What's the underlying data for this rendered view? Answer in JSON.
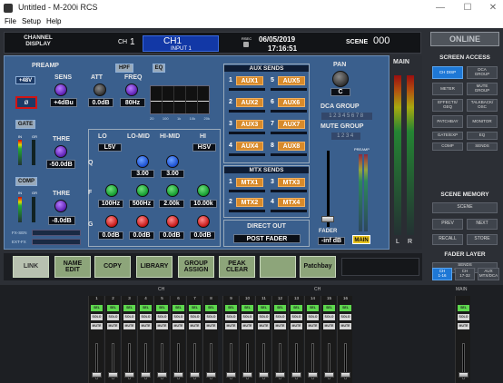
{
  "window": {
    "title": "Untitled - M-200i RCS",
    "minimize": "—",
    "maximize": "☐",
    "close": "✕"
  },
  "menu": [
    "File",
    "Setup",
    "Help"
  ],
  "header": {
    "channel_display": "CHANNEL\nDISPLAY",
    "ch_label": "CH",
    "ch_num": "1",
    "ch_name": "CH1",
    "input": "INPUT 1",
    "rs_label": "RSEC",
    "date": "06/05/2019",
    "time": "17:16:51",
    "scene_label": "SCENE",
    "scene_num": "000",
    "online": "ONLINE"
  },
  "preamp": {
    "title": "PREAMP",
    "phantom": "+48V",
    "sens_label": "SENS",
    "sens_value": "+4dBu",
    "phase": "ø",
    "att_label": "ATT",
    "att_value": "0.0dB",
    "hpf": "HPF",
    "eq": "EQ",
    "freq_label": "FREQ",
    "freq_value": "80Hz"
  },
  "graph": {
    "ticks": [
      "20",
      "100",
      "1k",
      "10k",
      "20k"
    ]
  },
  "gate": {
    "title": "GATE",
    "in": "IN",
    "gr": "GR",
    "thre": "THRE",
    "value": "-50.0dB"
  },
  "comp": {
    "title": "COMP",
    "in": "IN",
    "gr": "GR",
    "thre": "THRE",
    "value": "-8.0dB"
  },
  "fx": [
    "FX-SEN",
    "EXT-FX"
  ],
  "eq_bands": {
    "headers": [
      "LO",
      "LO-MID",
      "HI-MID",
      "HI"
    ],
    "types": [
      "L5V",
      "",
      "",
      "HSV"
    ],
    "q_label": "Q",
    "f_label": "F",
    "g_label": "G",
    "q": [
      "",
      "3.00",
      "3.00",
      ""
    ],
    "f": [
      "100Hz",
      "500Hz",
      "2.00k",
      "10.00k"
    ],
    "g": [
      "0.0dB",
      "0.0dB",
      "0.0dB",
      "0.0dB"
    ]
  },
  "aux_sends": {
    "title": "AUX SENDS",
    "items": [
      {
        "n": "1",
        "name": "AUX1"
      },
      {
        "n": "5",
        "name": "AUX5"
      },
      {
        "n": "2",
        "name": "AUX2"
      },
      {
        "n": "6",
        "name": "AUX6"
      },
      {
        "n": "3",
        "name": "AUX3"
      },
      {
        "n": "7",
        "name": "AUX7"
      },
      {
        "n": "4",
        "name": "AUX4"
      },
      {
        "n": "8",
        "name": "AUX8"
      }
    ]
  },
  "mtx_sends": {
    "title": "MTX SENDS",
    "items": [
      {
        "n": "1",
        "name": "MTX1"
      },
      {
        "n": "3",
        "name": "MTX3"
      },
      {
        "n": "2",
        "name": "MTX2"
      },
      {
        "n": "4",
        "name": "MTX4"
      }
    ]
  },
  "direct_out": {
    "title": "DIRECT OUT",
    "value": "POST FADER"
  },
  "pan": {
    "title": "PAN",
    "value": "C"
  },
  "dca": {
    "title": "DCA GROUP",
    "digits": "12345678"
  },
  "mute_group": {
    "title": "MUTE GROUP",
    "digits": "1234"
  },
  "fader": {
    "title": "FADER",
    "value": "-inf dB",
    "preamp": "PREAMP",
    "main": "MAIN"
  },
  "main_meter": {
    "title": "MAIN",
    "l": "L",
    "r": "R"
  },
  "functions": [
    "LINK",
    "NAME\nEDIT",
    "COPY",
    "LIBRARY",
    "GROUP\nASSIGN",
    "PEAK\nCLEAR",
    "",
    "Patchbay"
  ],
  "screen_access": {
    "title": "SCREEN ACCESS",
    "buttons": [
      "CH DISP",
      "DCA\nGROUP",
      "METER",
      "MUTE\nGROUP",
      "EFFECTS/\nGEQ",
      "TALKBACK/\nOSC",
      "PATCHBAY",
      "MONITOR",
      "GATE/EXP",
      "EQ",
      "COMP",
      "SENDS"
    ]
  },
  "scene_memory": {
    "title": "SCENE MEMORY",
    "scene": "SCENE",
    "prev": "PREV",
    "next": "NEXT",
    "recall": "RECALL",
    "store": "STORE"
  },
  "fader_layer": {
    "title": "FADER LAYER",
    "sends": "SENDS\nON FADER",
    "layers": [
      "CH\n1-16",
      "CH\n17-32",
      "AUX\nMTX/DCA"
    ]
  },
  "mixer": {
    "ch_label": "CH",
    "main_label": "MAIN",
    "sel": "SEL",
    "solo": "SOLO",
    "mute": "MUTE",
    "strips": [
      "1",
      "2",
      "3",
      "4",
      "5",
      "6",
      "7",
      "8",
      "9",
      "10",
      "11",
      "12",
      "13",
      "14",
      "15",
      "16"
    ]
  }
}
